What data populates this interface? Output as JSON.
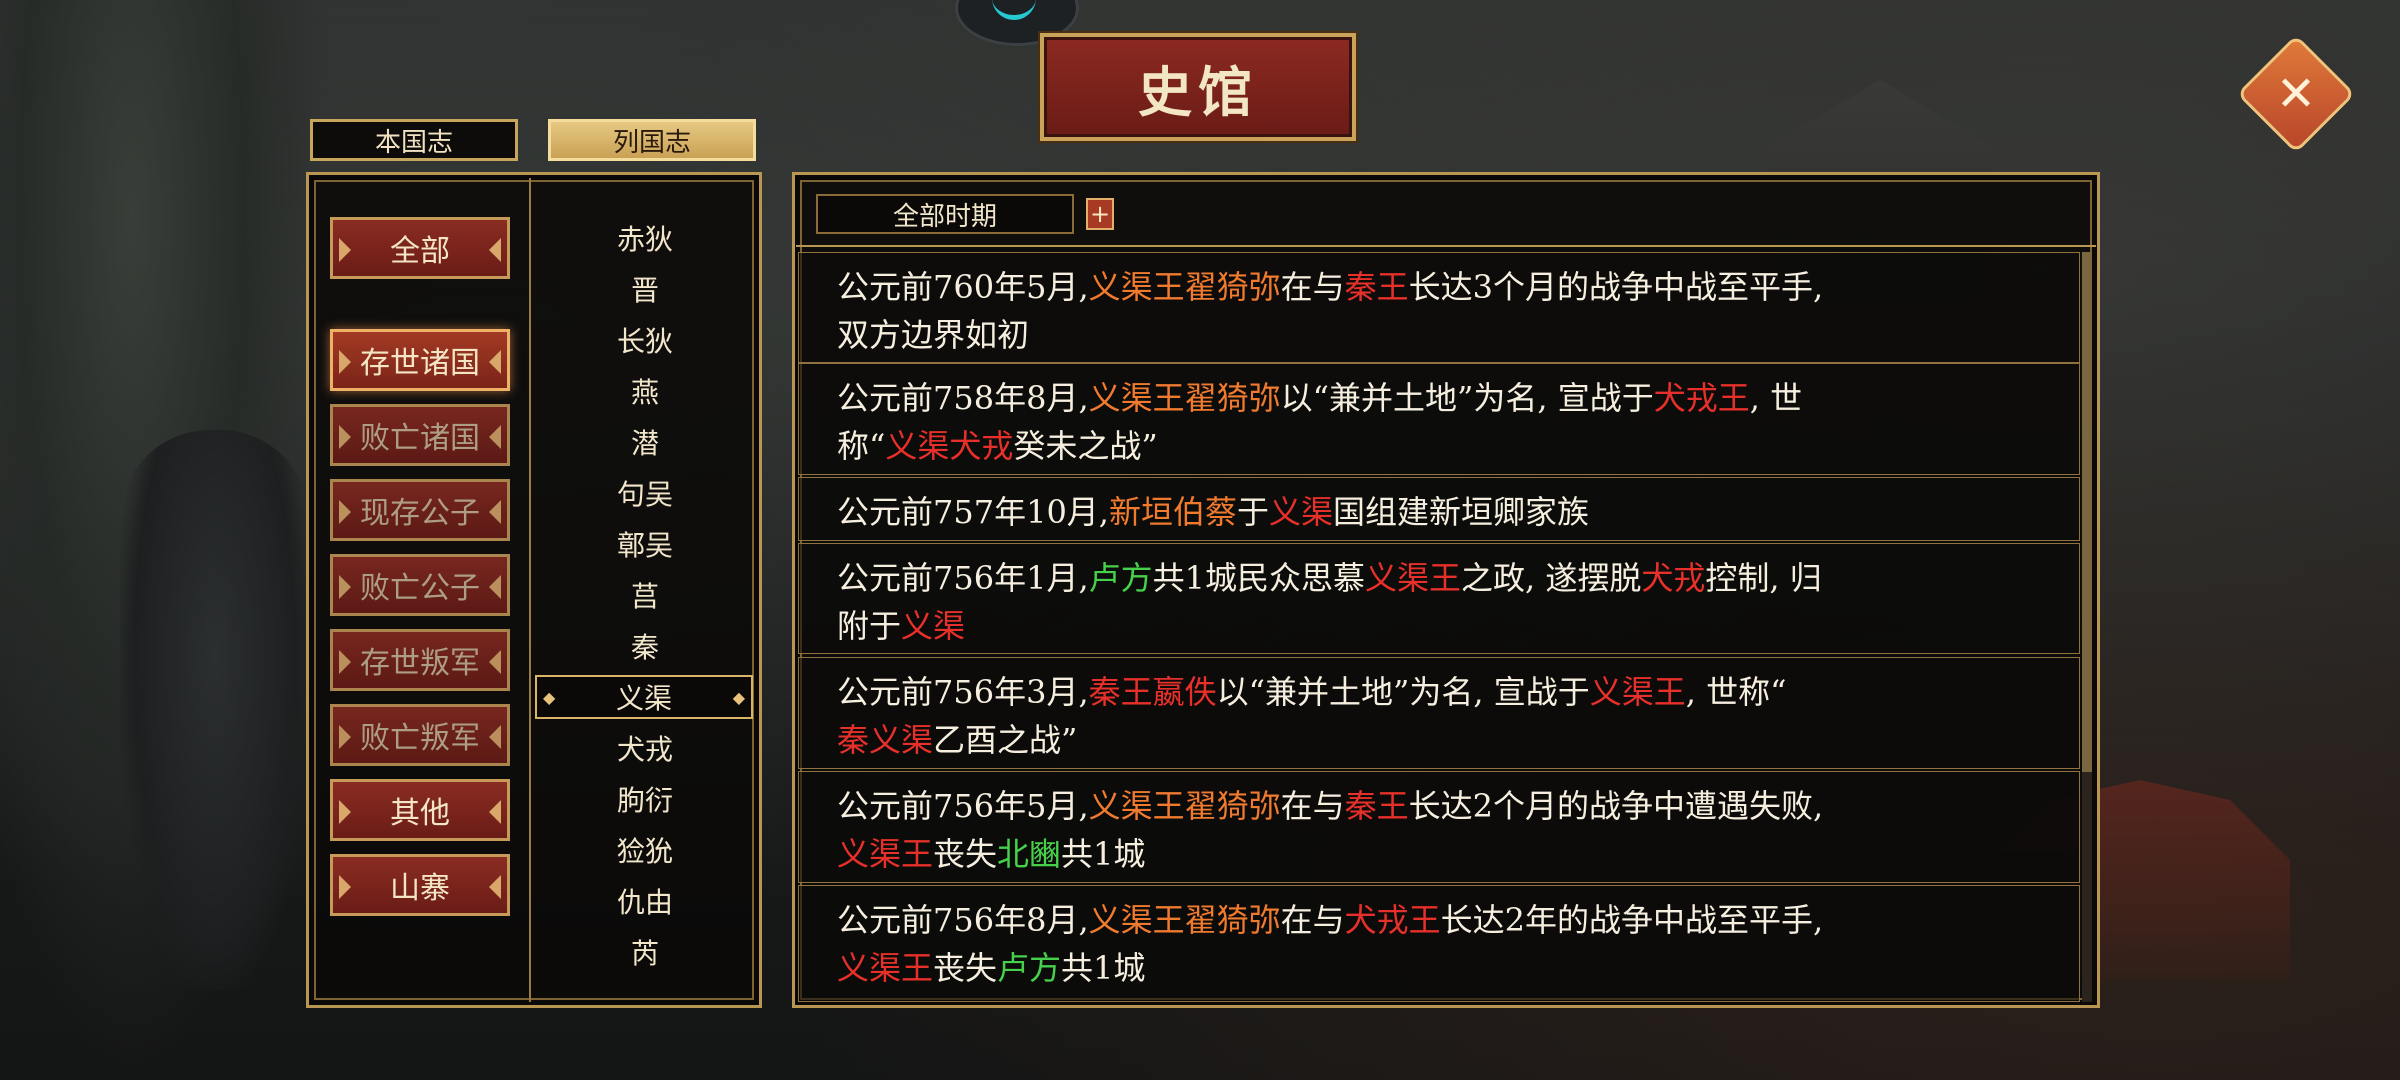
{
  "title": "史馆",
  "tabs": [
    {
      "label": "本国志",
      "active": false
    },
    {
      "label": "列国志",
      "active": true
    }
  ],
  "categories": [
    "全部",
    "存世诸国",
    "败亡诸国",
    "现存公子",
    "败亡公子",
    "存世叛军",
    "败亡叛军",
    "其他",
    "山寨"
  ],
  "selected_category": "存世诸国",
  "countries": [
    "赤狄",
    "晋",
    "长狄",
    "燕",
    "潜",
    "句吴",
    "鄣吴",
    "莒",
    "秦",
    "义渠",
    "犬戎",
    "朐衍",
    "猃狁",
    "仇由",
    "芮"
  ],
  "selected_country": "义渠",
  "period_filter": "全部时期",
  "colors": {
    "red": "#e8302a",
    "orange": "#f07a2e",
    "green": "#47d14a",
    "gold": "#b99651"
  },
  "entries": [
    [
      [
        "公元前760年5月,",
        "w"
      ],
      [
        "义渠王翟猗弥",
        "o"
      ],
      [
        "在与",
        "w"
      ],
      [
        "秦王",
        "r"
      ],
      [
        "长达3个月的战争中战至平手,",
        "w"
      ],
      [
        "\n",
        "br"
      ],
      [
        "双方边界如初",
        "w"
      ]
    ],
    [
      [
        "公元前758年8月,",
        "w"
      ],
      [
        "义渠王翟猗弥",
        "o"
      ],
      [
        "以“兼并土地”为名, 宣战于",
        "w"
      ],
      [
        "犬戎王",
        "r"
      ],
      [
        ", 世",
        "w"
      ],
      [
        "\n",
        "br"
      ],
      [
        "称“",
        "w"
      ],
      [
        "义渠犬戎",
        "r"
      ],
      [
        "癸未之战”",
        "w"
      ]
    ],
    [
      [
        "公元前757年10月,",
        "w"
      ],
      [
        "新垣伯蔡",
        "o"
      ],
      [
        "于",
        "w"
      ],
      [
        "义渠",
        "r"
      ],
      [
        "国组建新垣卿家族",
        "w"
      ]
    ],
    [
      [
        "公元前756年1月,",
        "w"
      ],
      [
        "卢方",
        "g"
      ],
      [
        "共1城民众思慕",
        "w"
      ],
      [
        "义渠王",
        "r"
      ],
      [
        "之政, 遂摆脱",
        "w"
      ],
      [
        "犬戎",
        "r"
      ],
      [
        "控制, 归",
        "w"
      ],
      [
        "\n",
        "br"
      ],
      [
        "附于",
        "w"
      ],
      [
        "义渠",
        "r"
      ]
    ],
    [
      [
        "公元前756年3月,",
        "w"
      ],
      [
        "秦王嬴佚",
        "r"
      ],
      [
        "以“兼并土地”为名, 宣战于",
        "w"
      ],
      [
        "义渠王",
        "r"
      ],
      [
        ", 世称“",
        "w"
      ],
      [
        "\n",
        "br"
      ],
      [
        "秦义渠",
        "r"
      ],
      [
        "乙酉之战”",
        "w"
      ]
    ],
    [
      [
        "公元前756年5月,",
        "w"
      ],
      [
        "义渠王翟猗弥",
        "o"
      ],
      [
        "在与",
        "w"
      ],
      [
        "秦王",
        "r"
      ],
      [
        "长达2个月的战争中遭遇失败,",
        "w"
      ],
      [
        "\n",
        "br"
      ],
      [
        "义渠王",
        "r"
      ],
      [
        "丧失",
        "w"
      ],
      [
        "北豳",
        "g"
      ],
      [
        "共1城",
        "w"
      ]
    ],
    [
      [
        "公元前756年8月,",
        "w"
      ],
      [
        "义渠王翟猗弥",
        "o"
      ],
      [
        "在与",
        "w"
      ],
      [
        "犬戎王",
        "r"
      ],
      [
        "长达2年的战争中战至平手,",
        "w"
      ],
      [
        "\n",
        "br"
      ],
      [
        "义渠王",
        "r"
      ],
      [
        "丧失",
        "w"
      ],
      [
        "卢方",
        "g"
      ],
      [
        "共1城",
        "w"
      ]
    ]
  ]
}
